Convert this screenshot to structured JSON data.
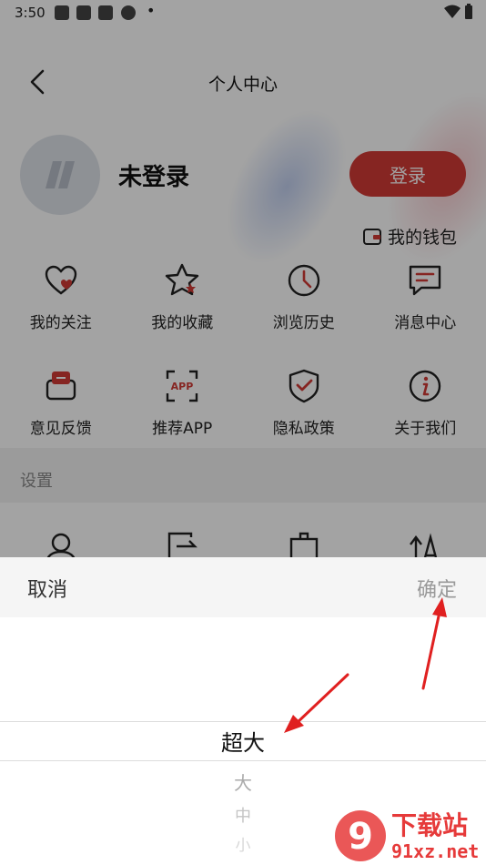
{
  "status_bar": {
    "time": "3:50",
    "dot": "•"
  },
  "nav": {
    "title": "个人中心"
  },
  "profile": {
    "username": "未登录",
    "login_label": "登录",
    "wallet_label": "我的钱包"
  },
  "menu_row1": [
    {
      "label": "我的关注",
      "icon": "heart-icon"
    },
    {
      "label": "我的收藏",
      "icon": "star-icon"
    },
    {
      "label": "浏览历史",
      "icon": "clock-icon"
    },
    {
      "label": "消息中心",
      "icon": "message-icon"
    }
  ],
  "menu_row2": [
    {
      "label": "意见反馈",
      "icon": "feedback-icon"
    },
    {
      "label": "推荐APP",
      "icon": "app-icon",
      "icon_text": "APP"
    },
    {
      "label": "隐私政策",
      "icon": "shield-icon"
    },
    {
      "label": "关于我们",
      "icon": "info-icon"
    }
  ],
  "settings": {
    "label": "设置"
  },
  "picker": {
    "cancel_label": "取消",
    "confirm_label": "确定",
    "options": [
      "超大",
      "大",
      "中",
      "小"
    ],
    "selected": "超大"
  },
  "watermark": {
    "text_large": "下载站",
    "text_small": "91xz.net",
    "logo_text": "9"
  },
  "colors": {
    "accent": "#d23a36",
    "dim_overlay": "rgba(0,0,0,0.36)",
    "arrow": "#e02020"
  }
}
